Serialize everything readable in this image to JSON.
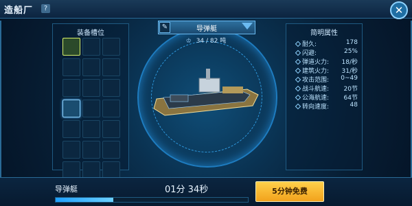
{
  "header": {
    "title": "造船厂",
    "help_label": "?",
    "close_label": "✕"
  },
  "left_panel": {
    "title": "装备槽位",
    "slots": [
      {
        "state": "equipped"
      },
      {
        "state": "empty"
      },
      {
        "state": "empty"
      },
      {
        "state": "empty"
      },
      {
        "state": "empty"
      },
      {
        "state": "empty"
      },
      {
        "state": "empty"
      },
      {
        "state": "empty"
      },
      {
        "state": "empty"
      },
      {
        "state": "active"
      },
      {
        "state": "empty"
      },
      {
        "state": "empty"
      },
      {
        "state": "empty"
      },
      {
        "state": "empty"
      },
      {
        "state": "empty"
      },
      {
        "state": "empty"
      },
      {
        "state": "empty"
      },
      {
        "state": "empty"
      },
      {
        "state": "empty"
      },
      {
        "state": "empty"
      },
      {
        "state": "empty"
      }
    ]
  },
  "center": {
    "ship_name": "导弹艇",
    "edit_icon": "✎",
    "capacity_label": "34 / 82 吨",
    "capacity_icon": "♔",
    "colors": {
      "ring": "#1e7cc0",
      "ship_hull": "#d9c07a",
      "ship_deck": "#2b3b4a"
    }
  },
  "right_panel": {
    "title": "简明属性",
    "stats": [
      {
        "label": "耐久:",
        "value": "178"
      },
      {
        "label": "闪避:",
        "value": "25%"
      },
      {
        "label": "弹道火力:",
        "value": "18/秒"
      },
      {
        "label": "建筑火力:",
        "value": "31/秒"
      },
      {
        "label": "攻击范围:",
        "value": "0~49"
      },
      {
        "label": "战斗航速:",
        "value": "20节"
      },
      {
        "label": "公海航速:",
        "value": "64节"
      },
      {
        "label": "转向速度:",
        "value": "48"
      }
    ]
  },
  "bottom": {
    "ship_name": "导弹艇",
    "time_left": "01分 34秒",
    "progress": 0.3,
    "free_button_label": "5分钟免费"
  }
}
